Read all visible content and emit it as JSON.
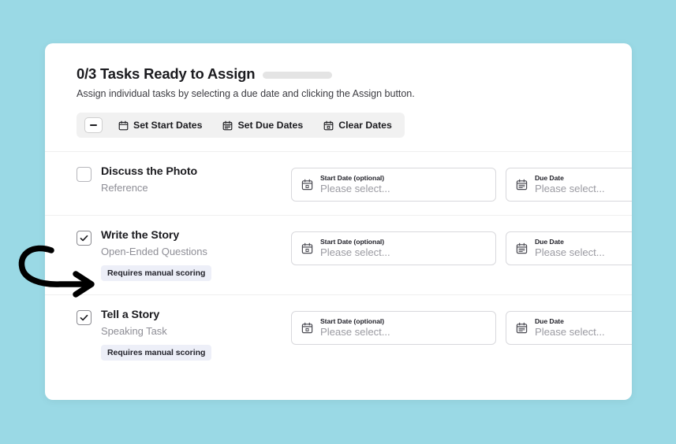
{
  "colors": {
    "background": "#9ad9e5",
    "card": "#ffffff",
    "toolbar_bg": "#f1f1f1",
    "badge_bg": "#edeff8",
    "text_primary": "#1b1b1f",
    "text_muted": "#8e8e96",
    "placeholder": "#9b9ba2",
    "border": "#d8d8dc",
    "divider": "#efefef",
    "skeleton": "#e4e4e4"
  },
  "header": {
    "title": "0/3 Tasks Ready to Assign",
    "subtitle": "Assign individual tasks by selecting a due date and clicking the Assign button."
  },
  "toolbar": {
    "collapse_icon": "minus-icon",
    "items": [
      {
        "label": "Set Start Dates",
        "icon": "calendar-start-icon"
      },
      {
        "label": "Set Due Dates",
        "icon": "calendar-due-icon"
      },
      {
        "label": "Clear Dates",
        "icon": "calendar-clear-icon"
      }
    ]
  },
  "fields": {
    "start_label": "Start Date (optional)",
    "due_label": "Due Date",
    "placeholder": "Please select..."
  },
  "tasks": [
    {
      "title": "Discuss the Photo",
      "subtitle": "Reference",
      "checked": false,
      "badge": null
    },
    {
      "title": "Write the Story",
      "subtitle": "Open-Ended Questions",
      "checked": true,
      "badge": "Requires manual scoring"
    },
    {
      "title": "Tell a Story",
      "subtitle": "Speaking Task",
      "checked": true,
      "badge": "Requires manual scoring"
    }
  ],
  "annotation": {
    "type": "curved-arrow",
    "points_to": "Requires manual scoring badge on Write the Story"
  }
}
